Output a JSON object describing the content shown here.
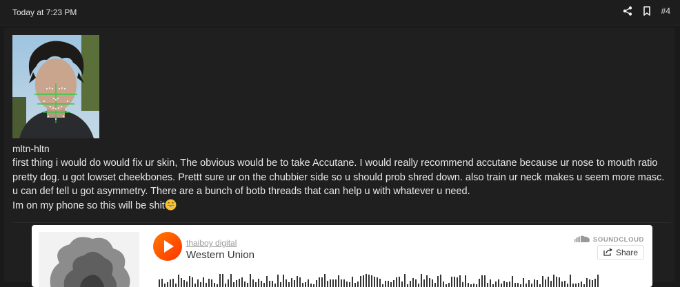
{
  "header": {
    "timestamp": "Today at 7:23 PM",
    "post_number": "#4"
  },
  "post": {
    "username": "mltn-hltn",
    "body_lines": [
      "first thing i would do would fix ur skin, The obvious would be to take Accutane. I would really recommend accutane because ur nose to mouth ratio pretty dog. u got lowset cheekbones. Prettt sure ur on the chubbier side so u should prob shred down. also train ur neck makes u seem more masc. u can def tell u got asymmetry. There are a bunch of botb threads that can help u with whatever u need.",
      "Im on my phone so this will be shit"
    ],
    "emoji": "grinning-face-with-sweat-icon"
  },
  "embed": {
    "artist": "thaiboy digital",
    "track": "Western Union",
    "brand": "SOUNDCLOUD",
    "share_label": "Share",
    "accent_color": "#ff5500"
  },
  "icons": {
    "share": "share-icon",
    "bookmark": "bookmark-icon",
    "play": "play-icon",
    "soundcloud": "soundcloud-logo-icon"
  }
}
